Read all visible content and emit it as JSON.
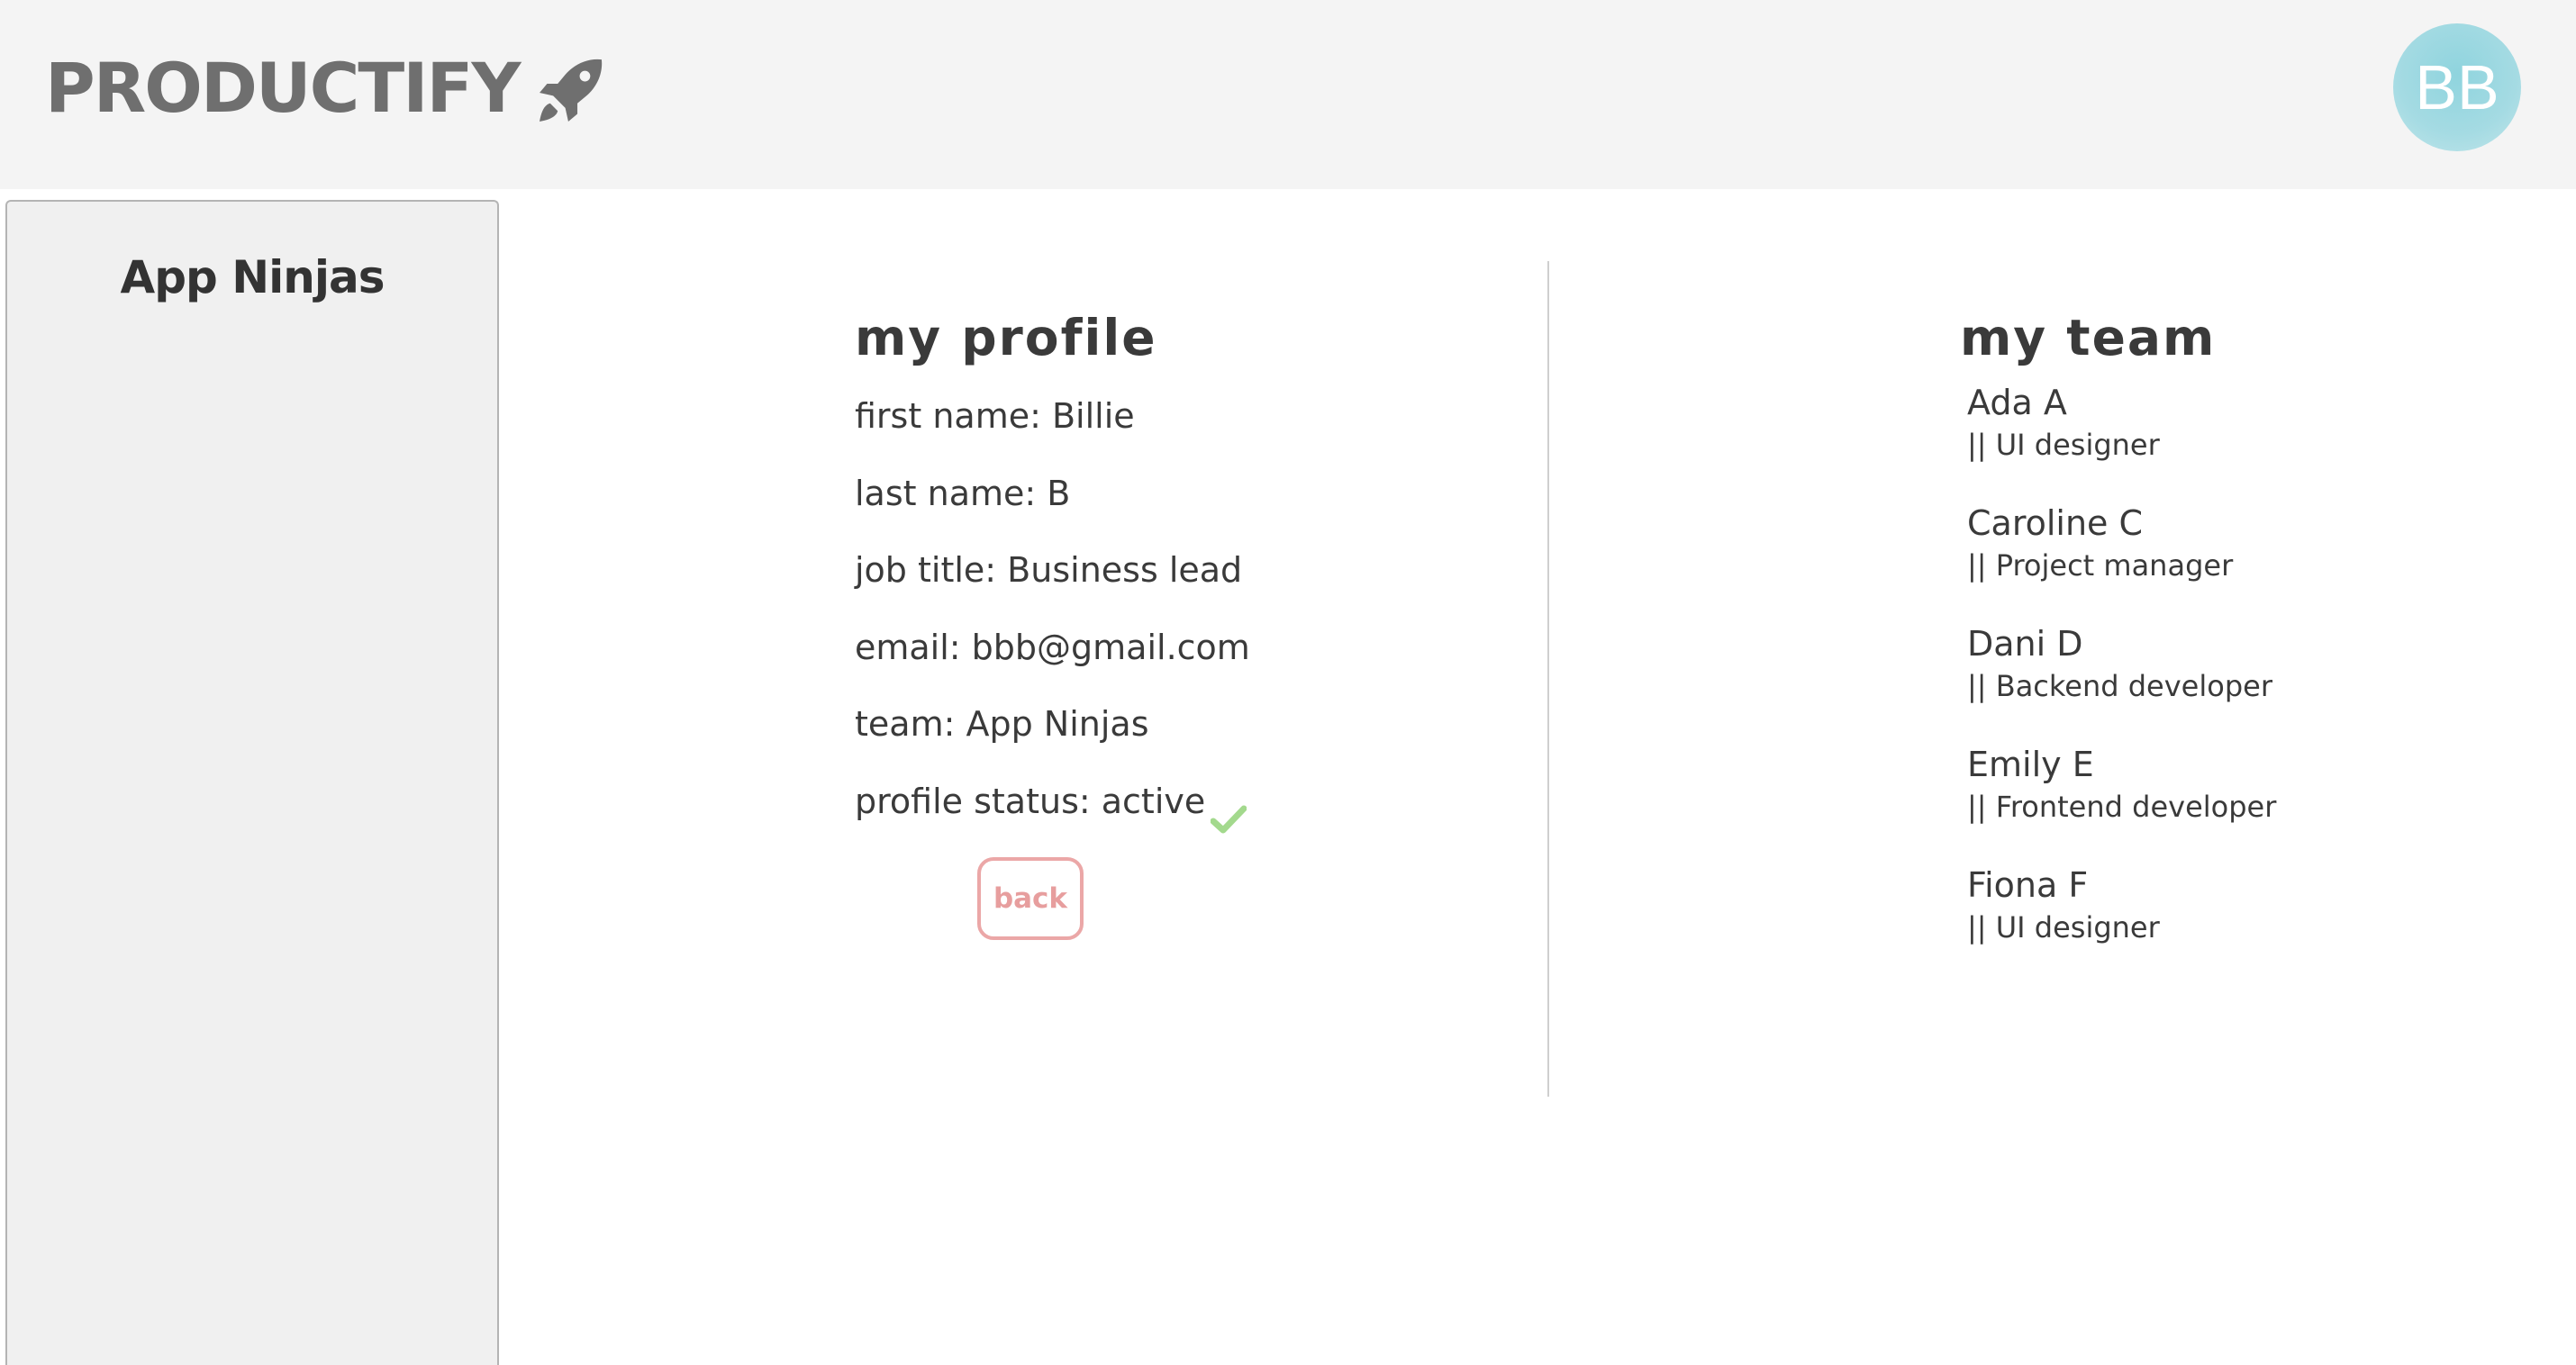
{
  "header": {
    "brand": "PRODUCTIFY",
    "brand_icon": "rocket-icon",
    "avatar_initials": "BB",
    "avatar_color": "#9fd8e0"
  },
  "sidebar": {
    "team_name": "App Ninjas"
  },
  "profile": {
    "title": "my profile",
    "fields": {
      "first_name": "first name: Billie",
      "last_name": "last name: B",
      "job_title": "job title: Business lead",
      "email": "email: bbb@gmail.com",
      "team": "team: App Ninjas",
      "status": "profile status: active"
    },
    "status_icon": "check-icon",
    "status_color": "#a3d98d",
    "back_label": "back",
    "back_color": "#eba7a7"
  },
  "team": {
    "title": "my team",
    "members": [
      {
        "name": "Ada A",
        "role": "|| UI designer"
      },
      {
        "name": "Caroline C",
        "role": "|| Project manager"
      },
      {
        "name": "Dani D",
        "role": "|| Backend developer"
      },
      {
        "name": "Emily E",
        "role": "|| Frontend developer"
      },
      {
        "name": "Fiona F",
        "role": "|| UI designer"
      }
    ]
  }
}
